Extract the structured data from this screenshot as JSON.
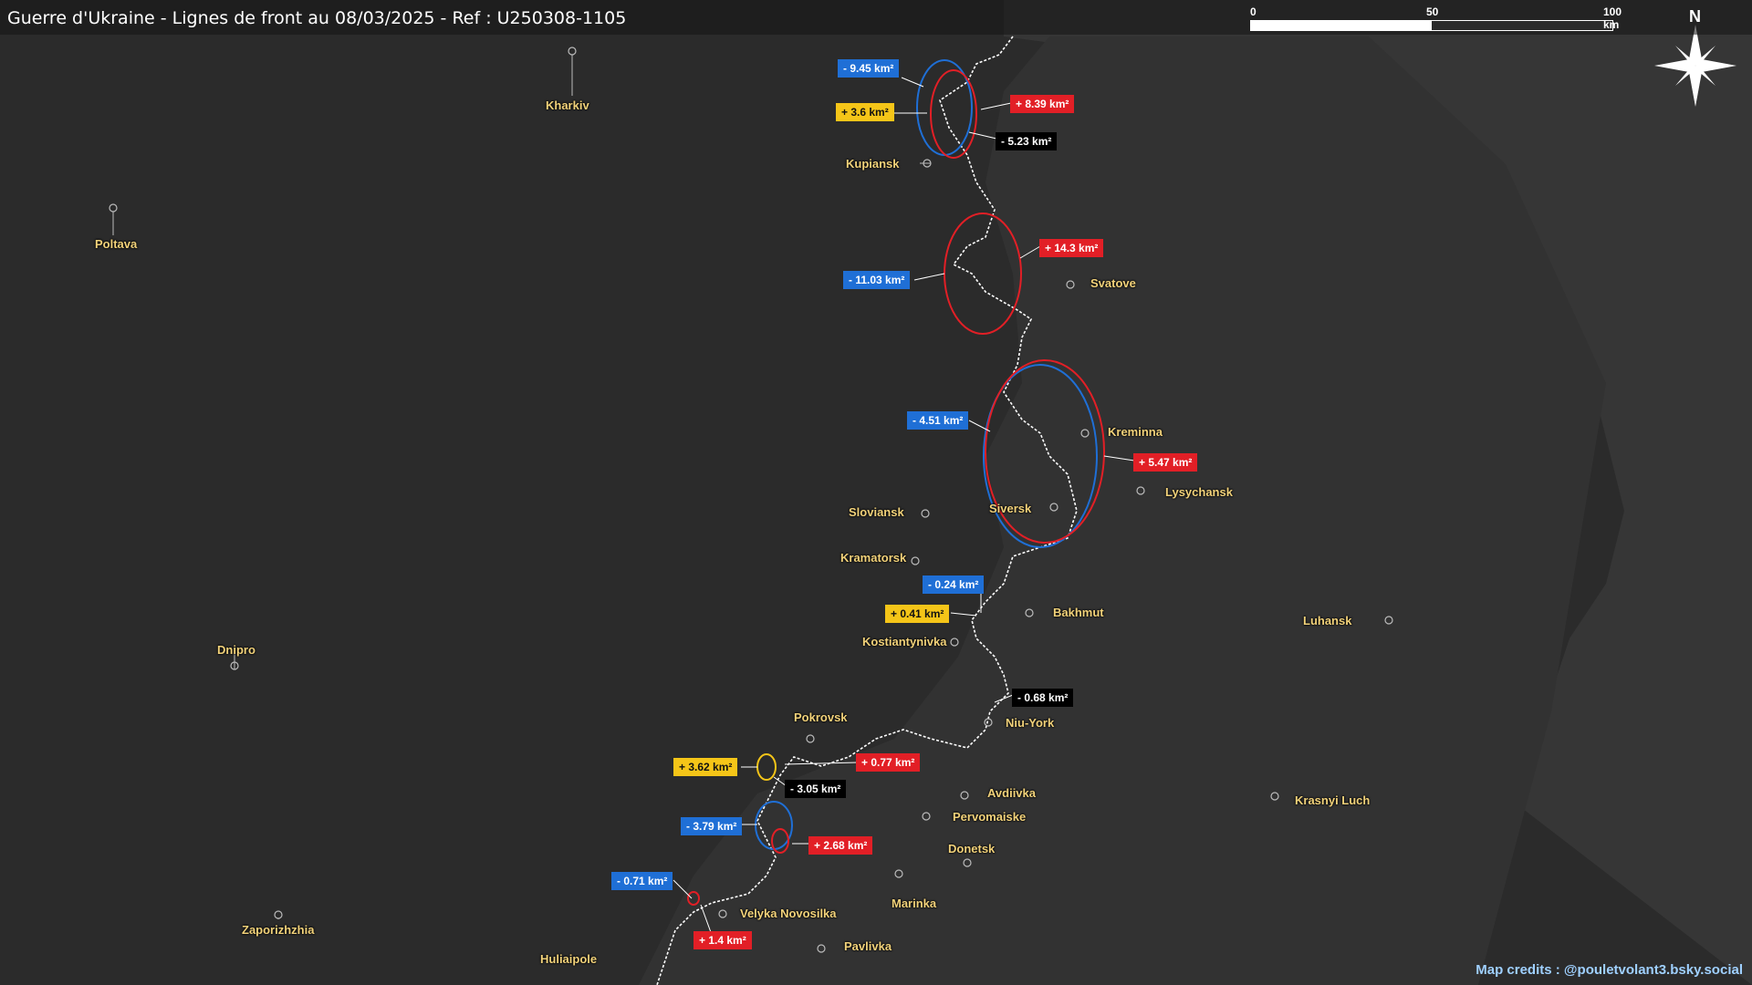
{
  "title": "Guerre d'Ukraine - Lignes de front au 08/03/2025 - Ref : U250308-1105",
  "scale": {
    "ticks": [
      "0",
      "50",
      "100 km"
    ]
  },
  "compass": {
    "label": "N"
  },
  "credits": "Map credits : @pouletvolant3.bsky.social",
  "colors": {
    "background": "#2b2b2b",
    "frontline": "#ffffff",
    "gain_red": "#e21f26",
    "loss_blue": "#1f6fd6",
    "yellow": "#f5c518",
    "city_label": "#f2d27a"
  },
  "cities": [
    "Kharkiv",
    "Poltava",
    "Kupiansk",
    "Svatove",
    "Kreminna",
    "Lysychansk",
    "Sloviansk",
    "Siversk",
    "Kramatorsk",
    "Bakhmut",
    "Kostiantynivka",
    "Luhansk",
    "Dnipro",
    "Pokrovsk",
    "Niu-York",
    "Avdiivka",
    "Pervomaiske",
    "Donetsk",
    "Krasnyi Luch",
    "Marinka",
    "Velyka Novosilka",
    "Zaporizhzhia",
    "Huliaipole",
    "Pavlivka"
  ],
  "callouts": [
    "- 9.45 km²",
    "+ 3.6 km²",
    "+ 8.39 km²",
    "- 5.23 km²",
    "+ 14.3 km²",
    "- 11.03 km²",
    "- 4.51 km²",
    "+ 5.47 km²",
    "- 0.24 km²",
    "+ 0.41 km²",
    "- 0.68 km²",
    "+ 3.62 km²",
    "+ 0.77 km²",
    "- 3.05 km²",
    "- 3.79 km²",
    "+ 2.68 km²",
    "- 0.71 km²",
    "+ 1.4 km²"
  ]
}
